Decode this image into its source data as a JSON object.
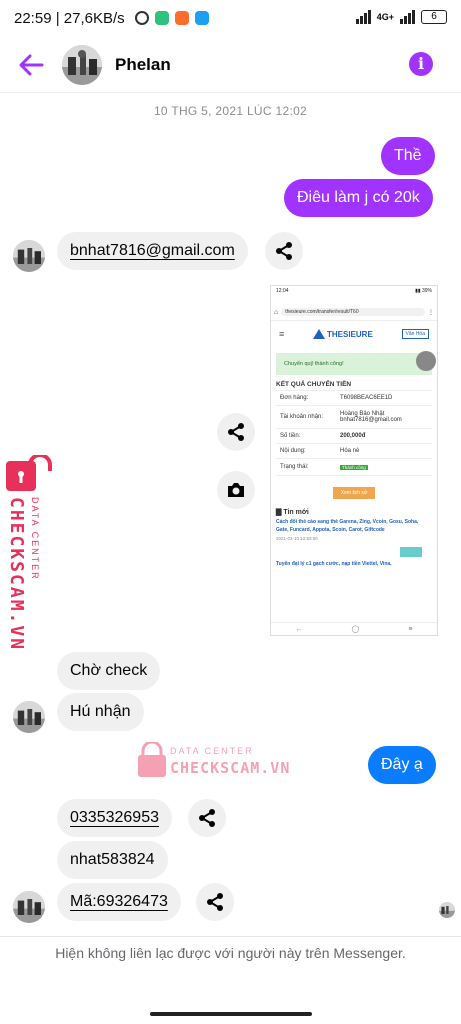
{
  "status": {
    "time_speed": "22:59 | 27,6KB/s",
    "network": "4G+",
    "battery": "6"
  },
  "header": {
    "contact_name": "Phelan"
  },
  "date_separator": "10 THG 5, 2021 LÚC 12:02",
  "messages": {
    "out1": "Thề",
    "out2": "Điêu làm j có 20k",
    "in_email": "bnhat7816@gmail.com",
    "in_check": "Chờ check",
    "in_hu": "Hú nhận",
    "out_day": "Đây ạ",
    "in_phone": "0335326953",
    "in_user": "nhat583824",
    "in_code": "Mã:69326473"
  },
  "attachment": {
    "url_bar": "thesieure.com/transfer/result/T60",
    "brand": "THESIEURE",
    "login": "Vân Hóa",
    "success_msg": "Chuyển quỹ thành công!",
    "section_title": "KẾT QUẢ CHUYỂN TIỀN",
    "rows": [
      {
        "label": "Đơn hàng:",
        "value": "T6098BEAC6EE1D"
      },
      {
        "label": "Tài khoản nhận:",
        "value": "Hoàng Bảo Nhật bnhat7816@gmail.com"
      },
      {
        "label": "Số tiền:",
        "value": "200,000đ"
      },
      {
        "label": "Nội dung:",
        "value": "Hóa nè"
      },
      {
        "label": "Trạng thái:",
        "value": "Thành công"
      }
    ],
    "history_button": "Xem lịch sử",
    "news_title": "Tin mới",
    "news1": "Cách đổi thẻ cào sang thẻ Garena, Zing, Vcoin, Gosu, Soha, Gate, Funcard, Appota, Scoin, Carot, Giftcode",
    "news1_date": "2021-03-10 12:53:00",
    "news2": "Tuyển đại lý c1 gạch cước, nạp tiền Viettel, Vina,"
  },
  "watermark": {
    "line1": "DATA CENTER",
    "line2": "CHECKSCAM.VN"
  },
  "footer": "Hiện không liên lạc được với người này trên Messenger.",
  "colors": {
    "accent": "#a033ff",
    "blue": "#0a7cff",
    "watermark": "#e8315a"
  }
}
